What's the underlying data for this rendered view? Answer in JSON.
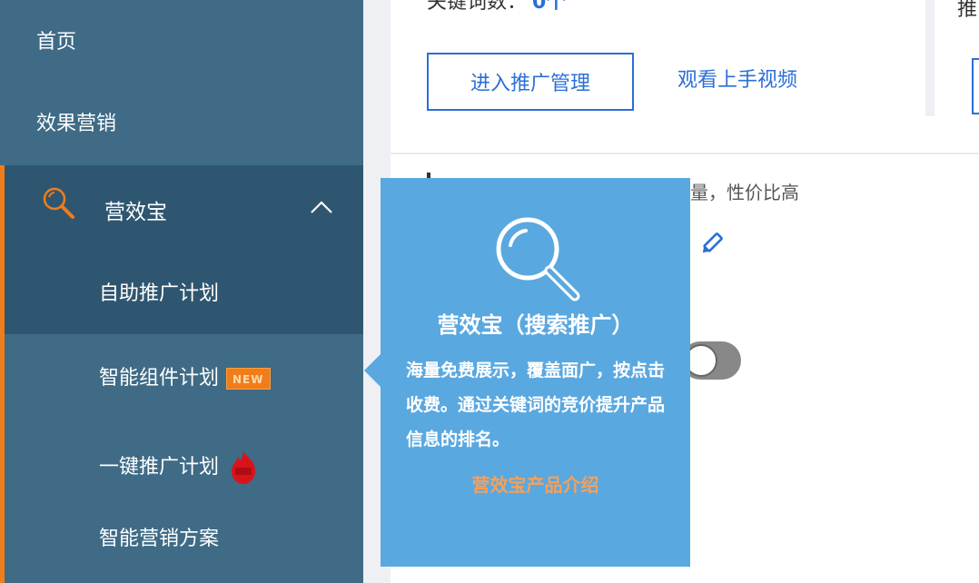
{
  "sidebar": {
    "home": "首页",
    "effect_marketing": "效果营销",
    "group": {
      "label": "营效宝",
      "icon": "search-icon",
      "items": [
        {
          "label": "自助推广计划"
        },
        {
          "label": "智能组件计划",
          "badge": "NEW"
        },
        {
          "label": "一键推广计划",
          "badge_icon": "hot-icon"
        },
        {
          "label": "智能营销方案"
        }
      ]
    }
  },
  "main": {
    "keyword_label": "关键词数：",
    "keyword_count": "0个",
    "manage_button": "进入推广管理",
    "video_link": "观看上手视频",
    "right_fragment": "推",
    "desc_tail": "量，性价比高"
  },
  "tooltip": {
    "title": "营效宝（搜索推广）",
    "body": "海量免费展示，覆盖面广，按点击收费。通过关键词的竞价提升产品信息的排名。",
    "link": "营效宝产品介绍"
  },
  "colors": {
    "sidebar_bg": "#3f6b86",
    "sidebar_active": "#2f5670",
    "accent_orange": "#f07d1a",
    "link_blue": "#2b6fd6",
    "tooltip_bg": "#5aa8e0"
  }
}
